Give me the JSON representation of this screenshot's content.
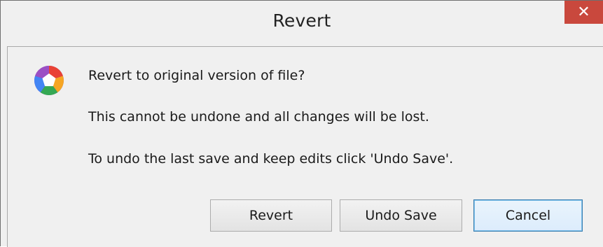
{
  "window": {
    "title": "Revert",
    "close_glyph": "✕"
  },
  "dialog": {
    "icon": "picasa-icon",
    "message_line1": "Revert to original version of file?",
    "message_line2": "This cannot be undone and all changes will be lost.",
    "message_line3": "To undo the last save and keep edits click 'Undo Save'."
  },
  "buttons": {
    "revert_label": "Revert",
    "undo_save_label": "Undo Save",
    "cancel_label": "Cancel"
  },
  "colors": {
    "close_button": "#c9483d",
    "default_button_border": "#3c7fb1"
  }
}
